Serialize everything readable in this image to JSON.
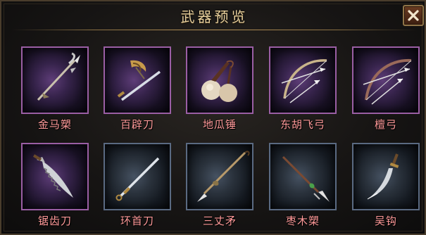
{
  "window": {
    "title": "武器预览"
  },
  "close_button": {
    "icon": "close-icon"
  },
  "colors": {
    "epic_frame": "#9a5ea4",
    "rare_frame": "#5a6a82",
    "name_text": "#ff9a9a",
    "title_text": "#e7cf9c"
  },
  "weapons": [
    {
      "name": "金马槊",
      "icon": "spear-icon",
      "rarity": "purple"
    },
    {
      "name": "百辟刀",
      "icon": "sword-icon",
      "rarity": "purple"
    },
    {
      "name": "地瓜锤",
      "icon": "mace-icon",
      "rarity": "purple"
    },
    {
      "name": "东胡飞弓",
      "icon": "bow-icon",
      "rarity": "purple"
    },
    {
      "name": "檀弓",
      "icon": "bow-icon",
      "rarity": "purple"
    },
    {
      "name": "锯齿刀",
      "icon": "saw-blade-icon",
      "rarity": "purple"
    },
    {
      "name": "环首刀",
      "icon": "sword-icon",
      "rarity": "blue"
    },
    {
      "name": "三丈矛",
      "icon": "spear-icon",
      "rarity": "blue"
    },
    {
      "name": "枣木槊",
      "icon": "spear-icon",
      "rarity": "blue"
    },
    {
      "name": "吴钩",
      "icon": "hook-blade-icon",
      "rarity": "blue"
    }
  ]
}
